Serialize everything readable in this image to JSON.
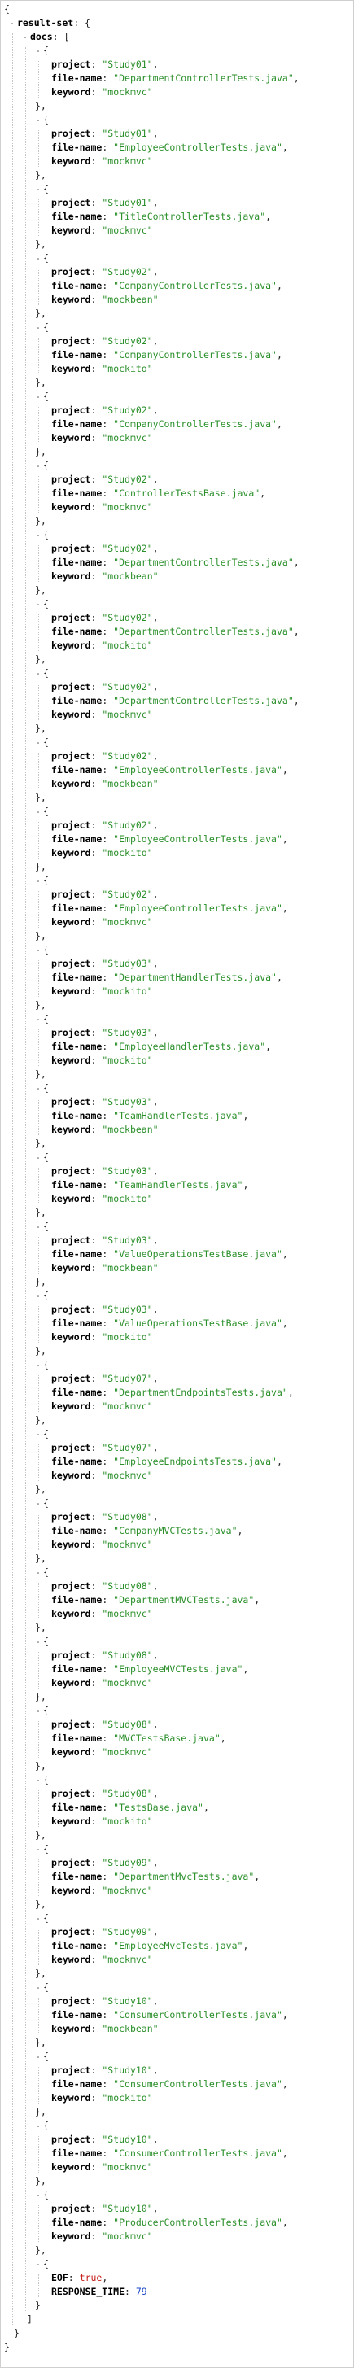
{
  "viewer": {
    "result_key": "result-set",
    "docs_key": "docs",
    "toggle_symbol": "-",
    "keys": {
      "project": "project",
      "file": "file-name",
      "keyword": "keyword"
    },
    "docs": [
      {
        "project": "Study01",
        "file": "DepartmentControllerTests.java",
        "keyword": "mockmvc"
      },
      {
        "project": "Study01",
        "file": "EmployeeControllerTests.java",
        "keyword": "mockmvc"
      },
      {
        "project": "Study01",
        "file": "TitleControllerTests.java",
        "keyword": "mockmvc"
      },
      {
        "project": "Study02",
        "file": "CompanyControllerTests.java",
        "keyword": "mockbean"
      },
      {
        "project": "Study02",
        "file": "CompanyControllerTests.java",
        "keyword": "mockito"
      },
      {
        "project": "Study02",
        "file": "CompanyControllerTests.java",
        "keyword": "mockmvc"
      },
      {
        "project": "Study02",
        "file": "ControllerTestsBase.java",
        "keyword": "mockmvc"
      },
      {
        "project": "Study02",
        "file": "DepartmentControllerTests.java",
        "keyword": "mockbean"
      },
      {
        "project": "Study02",
        "file": "DepartmentControllerTests.java",
        "keyword": "mockito"
      },
      {
        "project": "Study02",
        "file": "DepartmentControllerTests.java",
        "keyword": "mockmvc"
      },
      {
        "project": "Study02",
        "file": "EmployeeControllerTests.java",
        "keyword": "mockbean"
      },
      {
        "project": "Study02",
        "file": "EmployeeControllerTests.java",
        "keyword": "mockito"
      },
      {
        "project": "Study02",
        "file": "EmployeeControllerTests.java",
        "keyword": "mockmvc"
      },
      {
        "project": "Study03",
        "file": "DepartmentHandlerTests.java",
        "keyword": "mockito"
      },
      {
        "project": "Study03",
        "file": "EmployeeHandlerTests.java",
        "keyword": "mockito"
      },
      {
        "project": "Study03",
        "file": "TeamHandlerTests.java",
        "keyword": "mockbean"
      },
      {
        "project": "Study03",
        "file": "TeamHandlerTests.java",
        "keyword": "mockito"
      },
      {
        "project": "Study03",
        "file": "ValueOperationsTestBase.java",
        "keyword": "mockbean"
      },
      {
        "project": "Study03",
        "file": "ValueOperationsTestBase.java",
        "keyword": "mockito"
      },
      {
        "project": "Study07",
        "file": "DepartmentEndpointsTests.java",
        "keyword": "mockmvc"
      },
      {
        "project": "Study07",
        "file": "EmployeeEndpointsTests.java",
        "keyword": "mockmvc"
      },
      {
        "project": "Study08",
        "file": "CompanyMVCTests.java",
        "keyword": "mockmvc"
      },
      {
        "project": "Study08",
        "file": "DepartmentMVCTests.java",
        "keyword": "mockmvc"
      },
      {
        "project": "Study08",
        "file": "EmployeeMVCTests.java",
        "keyword": "mockmvc"
      },
      {
        "project": "Study08",
        "file": "MVCTestsBase.java",
        "keyword": "mockmvc"
      },
      {
        "project": "Study08",
        "file": "TestsBase.java",
        "keyword": "mockito"
      },
      {
        "project": "Study09",
        "file": "DepartmentMvcTests.java",
        "keyword": "mockmvc"
      },
      {
        "project": "Study09",
        "file": "EmployeeMvcTests.java",
        "keyword": "mockmvc"
      },
      {
        "project": "Study10",
        "file": "ConsumerControllerTests.java",
        "keyword": "mockbean"
      },
      {
        "project": "Study10",
        "file": "ConsumerControllerTests.java",
        "keyword": "mockito"
      },
      {
        "project": "Study10",
        "file": "ConsumerControllerTests.java",
        "keyword": "mockmvc"
      },
      {
        "project": "Study10",
        "file": "ProducerControllerTests.java",
        "keyword": "mockmvc"
      }
    ],
    "footer": {
      "eof_key": "EOF",
      "eof_value": "true",
      "response_time_key": "RESPONSE_TIME",
      "response_time_value": "79"
    }
  }
}
